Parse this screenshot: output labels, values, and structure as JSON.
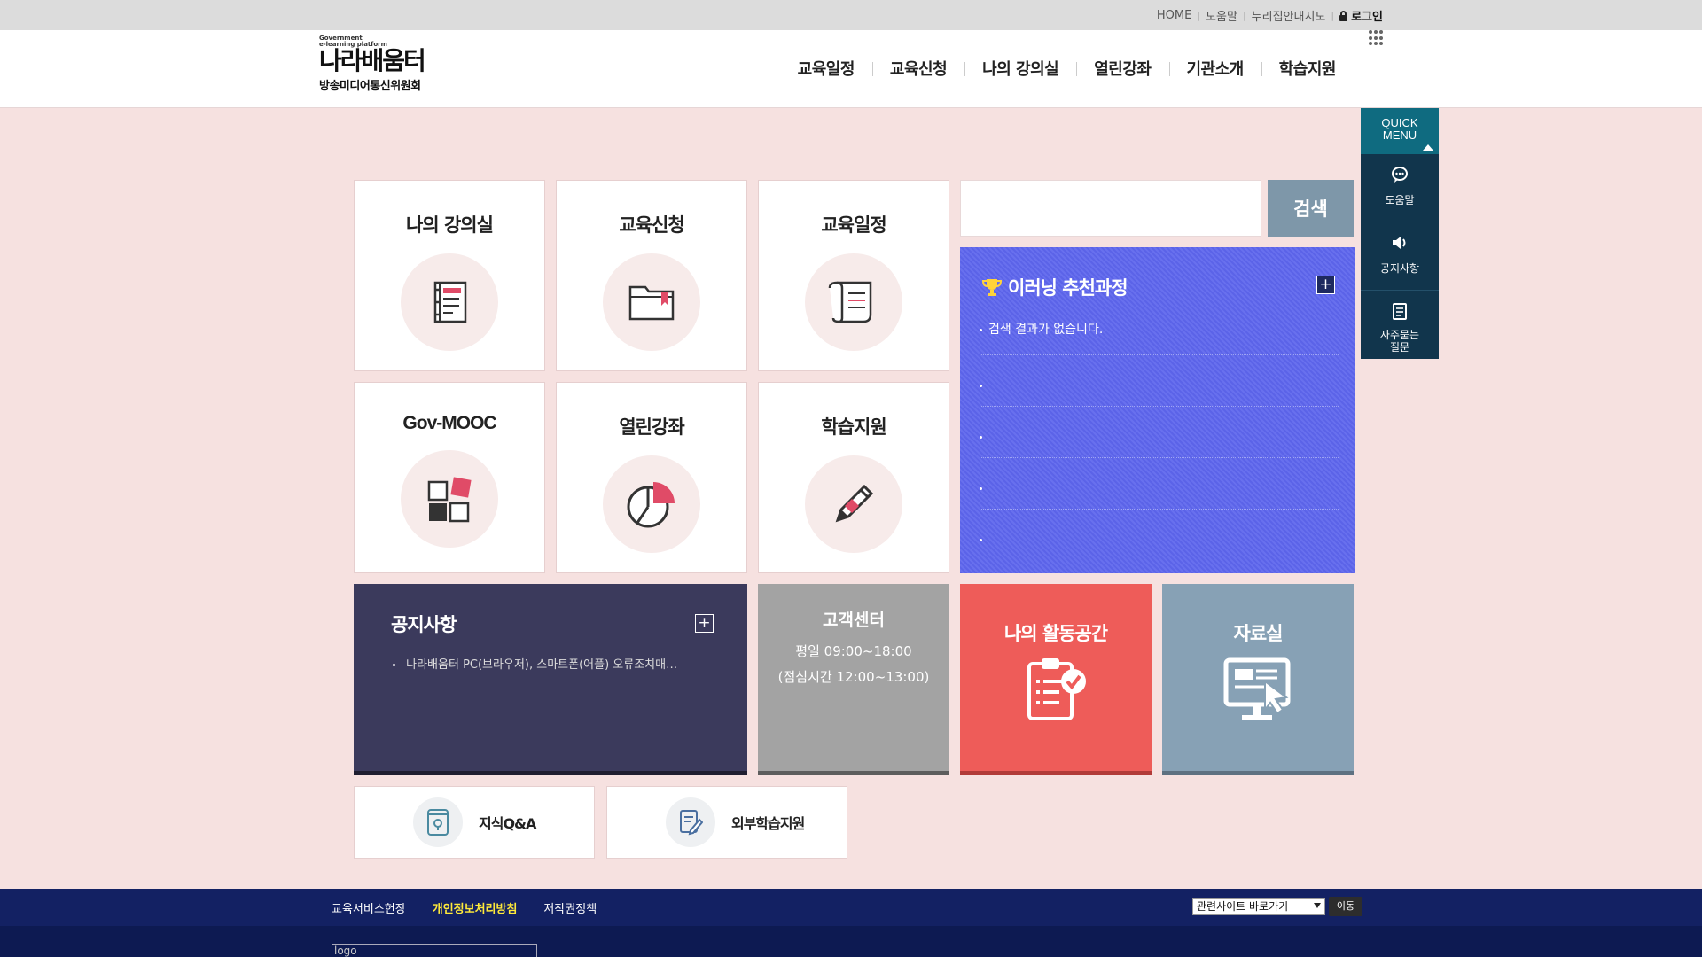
{
  "util_links": [
    "HOME",
    "도움말",
    "누리집안내지도"
  ],
  "login_label": "로그인",
  "logo": {
    "tagline_1": "Government",
    "tagline_2": "e-learning platform",
    "name": "나라배움터",
    "org": "방송미디어통신위원회"
  },
  "gnb": [
    "교육일정",
    "교육신청",
    "나의 강의실",
    "열린강좌",
    "기관소개",
    "학습지원"
  ],
  "quick_menu": {
    "title": "QUICK MENU",
    "items": [
      {
        "label": "도움말",
        "icon": "chat-bubble-icon"
      },
      {
        "label": "공지사항",
        "icon": "speaker-icon"
      },
      {
        "label": "자주묻는 질문",
        "icon": "notepad-icon"
      }
    ]
  },
  "tiles": [
    {
      "label": "나의 강의실",
      "icon": "notebook-icon"
    },
    {
      "label": "교육신청",
      "icon": "folder-icon"
    },
    {
      "label": "교육일정",
      "icon": "scroll-icon"
    },
    {
      "label": "Gov-MOOC",
      "icon": "blocks-icon"
    },
    {
      "label": "열린강좌",
      "icon": "pie-chart-icon"
    },
    {
      "label": "학습지원",
      "icon": "pencil-icon"
    }
  ],
  "search": {
    "placeholder": "",
    "button": "검색"
  },
  "recommend": {
    "title": "이러닝 추천과정",
    "plus": "+",
    "items": [
      "검색 결과가 없습니다.",
      "",
      "",
      "",
      ""
    ]
  },
  "notice": {
    "title": "공지사항",
    "plus": "+",
    "item": "나라배움터 PC(브라우저), 스마트폰(어플) 오류조치매…"
  },
  "customer_center": {
    "title": "고객센터",
    "hours": "평일 09:00~18:00",
    "lunch": "(점심시간 12:00~13:00)"
  },
  "activity": {
    "title": "나의 활동공간"
  },
  "archive": {
    "title": "자료실"
  },
  "small_cards": [
    {
      "label": "지식Q&A",
      "icon": "location-book-icon"
    },
    {
      "label": "외부학습지원",
      "icon": "document-pen-icon"
    }
  ],
  "footer": {
    "links": [
      "교육서비스헌장",
      "개인정보처리방침",
      "저작권정책"
    ],
    "related_select": "관련사이트 바로가기",
    "go_button": "이동",
    "logo_alt": "logo"
  },
  "colors": {
    "background": "#f6e1e0",
    "quick_header": "#0f6b80",
    "quick_body": "#11354c",
    "recommend": "#5b63e8",
    "notice": "#3b3a5c",
    "customer_center": "#a3a3a3",
    "activity": "#ee5c59",
    "archive": "#87a1b5",
    "footer": "#132163",
    "footer_highlight": "#ffea3a"
  }
}
